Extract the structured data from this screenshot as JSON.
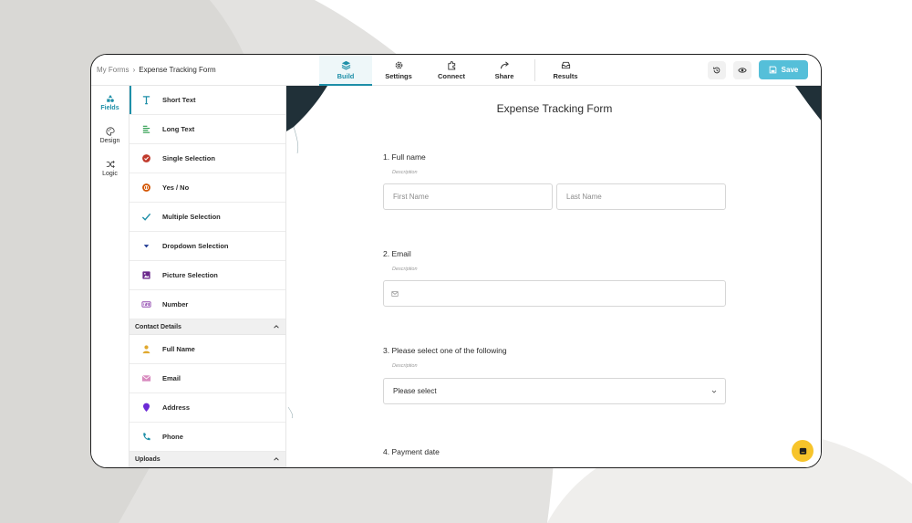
{
  "breadcrumb": {
    "root": "My Forms",
    "separator": "›",
    "current": "Expense Tracking Form"
  },
  "nav": {
    "items": [
      {
        "label": "Build",
        "icon": "layers-icon",
        "active": true
      },
      {
        "label": "Settings",
        "icon": "gear-icon"
      },
      {
        "label": "Connect",
        "icon": "puzzle-icon"
      },
      {
        "label": "Share",
        "icon": "share-arrow-icon"
      },
      {
        "label": "Results",
        "icon": "inbox-icon"
      }
    ]
  },
  "toolbar": {
    "save_label": "Save",
    "history_icon": "history-icon",
    "preview_icon": "eye-icon",
    "save_icon": "floppy-icon"
  },
  "rail": {
    "items": [
      {
        "label": "Fields",
        "icon": "shapes-icon",
        "active": true
      },
      {
        "label": "Design",
        "icon": "palette-icon"
      },
      {
        "label": "Logic",
        "icon": "shuffle-icon"
      }
    ]
  },
  "fields": {
    "basic": [
      {
        "label": "Short Text",
        "icon": "text-t-icon",
        "color": "#1e8fa8"
      },
      {
        "label": "Long Text",
        "icon": "paragraph-icon",
        "color": "#2e9e4f"
      },
      {
        "label": "Single Selection",
        "icon": "radio-check-icon",
        "color": "#c0392b"
      },
      {
        "label": "Yes / No",
        "icon": "yes-no-icon",
        "color": "#d35400"
      },
      {
        "label": "Multiple Selection",
        "icon": "checkmark-icon",
        "color": "#1e8fa8"
      },
      {
        "label": "Dropdown Selection",
        "icon": "caret-down-icon",
        "color": "#1f3a93"
      },
      {
        "label": "Picture Selection",
        "icon": "picture-icon",
        "color": "#6c2a8c"
      },
      {
        "label": "Number",
        "icon": "number-icon",
        "color": "#8e44ad"
      }
    ],
    "contact_header": "Contact Details",
    "contact": [
      {
        "label": "Full Name",
        "icon": "person-icon",
        "color": "#e0a82e"
      },
      {
        "label": "Email",
        "icon": "envelope-icon",
        "color": "#d88bbf"
      },
      {
        "label": "Address",
        "icon": "map-pin-icon",
        "color": "#6c2ad6"
      },
      {
        "label": "Phone",
        "icon": "phone-icon",
        "color": "#1e8fa8"
      }
    ],
    "uploads_header": "Uploads"
  },
  "form": {
    "title": "Expense Tracking Form",
    "questions": [
      {
        "label": "1. Full name",
        "description": "Description",
        "first_placeholder": "First Name",
        "last_placeholder": "Last Name"
      },
      {
        "label": "2. Email",
        "description": "Description",
        "email_icon": "envelope-icon"
      },
      {
        "label": "3. Please select one of the following",
        "description": "Description",
        "select_value": "Please select"
      },
      {
        "label": "4. Payment date"
      }
    ]
  },
  "chat": {
    "icon": "chat-bubble-icon",
    "color": "#f7c42b"
  }
}
